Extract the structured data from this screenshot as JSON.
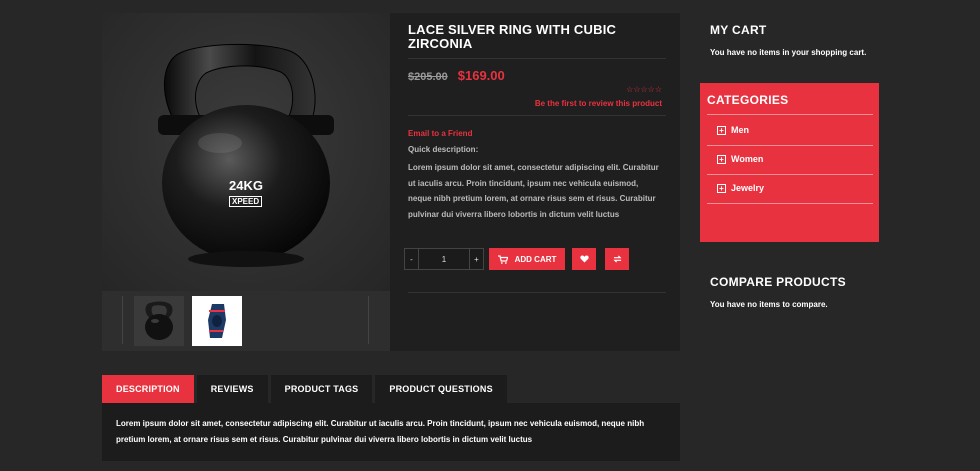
{
  "product": {
    "title": "LACE SILVER RING WITH CUBIC ZIRCONIA",
    "old_price": "$205.00",
    "new_price": "$169.00",
    "rating_stars": "☆☆☆☆☆",
    "review_link": "Be the first to review this product",
    "email_link": "Email to a Friend",
    "quick_label": "Quick description:",
    "quick_text": "Lorem ipsum dolor sit amet, consectetur adipiscing elit. Curabitur ut iaculis arcu. Proin tincidunt, ipsum nec vehicula euismod, neque nibh pretium lorem, at ornare risus sem et risus. Curabitur pulvinar dui viverra libero lobortis in dictum velit luctus",
    "image_weight_text": "24KG",
    "image_brand_text": "XPEED"
  },
  "purchase": {
    "qty_minus": "-",
    "qty_value": "1",
    "qty_plus": "+",
    "add_cart_label": "ADD CART"
  },
  "tabs": [
    {
      "label": "DESCRIPTION",
      "active": true
    },
    {
      "label": "REVIEWS",
      "active": false
    },
    {
      "label": "PRODUCT TAGS",
      "active": false
    },
    {
      "label": "PRODUCT QUESTIONS",
      "active": false
    }
  ],
  "description_text": "Lorem ipsum dolor sit amet, consectetur adipiscing elit. Curabitur ut iaculis arcu. Proin tincidunt, ipsum nec vehicula euismod, neque nibh pretium lorem, at ornare risus sem et risus. Curabitur pulvinar dui viverra libero lobortis in dictum velit luctus",
  "sidebar": {
    "cart_title": "MY CART",
    "cart_text": "You have no items in your shopping cart.",
    "categories_title": "CATEGORIES",
    "categories": [
      {
        "label": "Men"
      },
      {
        "label": "Women"
      },
      {
        "label": "Jewelry"
      }
    ],
    "compare_title": "COMPARE PRODUCTS",
    "compare_text": "You have no items to compare."
  },
  "colors": {
    "accent": "#e8323f",
    "background": "#272727",
    "panel": "#1f1f1f"
  },
  "icons": [
    "cart-icon",
    "heart-icon",
    "compare-icon",
    "plus-square-icon"
  ]
}
